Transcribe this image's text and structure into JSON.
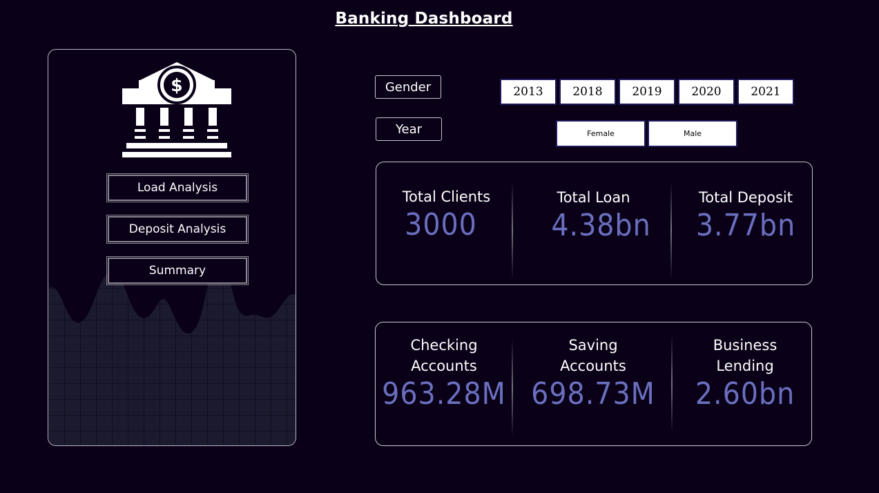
{
  "header": {
    "title": "Banking Dashboard"
  },
  "nav": {
    "logo_icon": "bank-dollar-icon",
    "buttons": [
      "Load Analysis",
      "Deposit Analysis",
      "Summary"
    ]
  },
  "filters": {
    "gender_label": "Gender",
    "year_label": "Year",
    "years": [
      "2013",
      "2018",
      "2019",
      "2020",
      "2021"
    ],
    "genders": [
      "Female",
      "Male"
    ]
  },
  "kpis_top": [
    {
      "label": "Total Clients",
      "value": "3000"
    },
    {
      "label": "Total Loan",
      "value": "4.38bn"
    },
    {
      "label": "Total Deposit",
      "value": "3.77bn"
    }
  ],
  "kpis_bottom": [
    {
      "label_line1": "Checking",
      "label_line2": "Accounts",
      "value": "963.28M"
    },
    {
      "label_line1": "Saving",
      "label_line2": "Accounts",
      "value": "698.73M"
    },
    {
      "label_line1": "Business",
      "label_line2": "Lending",
      "value": "2.60bn"
    }
  ],
  "colors": {
    "background": "#0a0118",
    "accent": "#6a6fbf",
    "chip_border": "#1e1a5c"
  }
}
